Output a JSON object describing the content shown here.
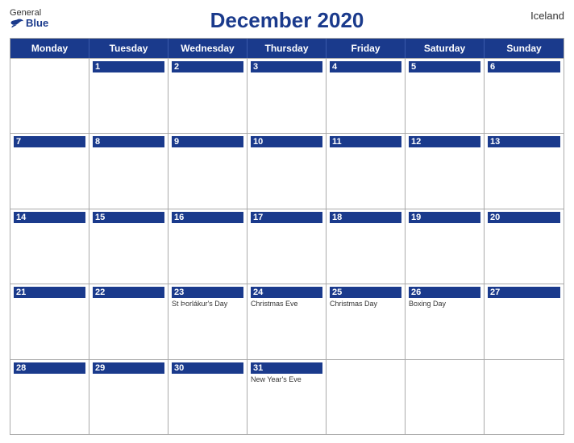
{
  "header": {
    "logo_general": "General",
    "logo_blue": "Blue",
    "title": "December 2020",
    "country": "Iceland"
  },
  "day_headers": [
    "Monday",
    "Tuesday",
    "Wednesday",
    "Thursday",
    "Friday",
    "Saturday",
    "Sunday"
  ],
  "weeks": [
    [
      {
        "day": "",
        "holiday": ""
      },
      {
        "day": "1",
        "holiday": ""
      },
      {
        "day": "2",
        "holiday": ""
      },
      {
        "day": "3",
        "holiday": ""
      },
      {
        "day": "4",
        "holiday": ""
      },
      {
        "day": "5",
        "holiday": ""
      },
      {
        "day": "6",
        "holiday": ""
      }
    ],
    [
      {
        "day": "7",
        "holiday": ""
      },
      {
        "day": "8",
        "holiday": ""
      },
      {
        "day": "9",
        "holiday": ""
      },
      {
        "day": "10",
        "holiday": ""
      },
      {
        "day": "11",
        "holiday": ""
      },
      {
        "day": "12",
        "holiday": ""
      },
      {
        "day": "13",
        "holiday": ""
      }
    ],
    [
      {
        "day": "14",
        "holiday": ""
      },
      {
        "day": "15",
        "holiday": ""
      },
      {
        "day": "16",
        "holiday": ""
      },
      {
        "day": "17",
        "holiday": ""
      },
      {
        "day": "18",
        "holiday": ""
      },
      {
        "day": "19",
        "holiday": ""
      },
      {
        "day": "20",
        "holiday": ""
      }
    ],
    [
      {
        "day": "21",
        "holiday": ""
      },
      {
        "day": "22",
        "holiday": ""
      },
      {
        "day": "23",
        "holiday": "St Þorlákur's Day"
      },
      {
        "day": "24",
        "holiday": "Christmas Eve"
      },
      {
        "day": "25",
        "holiday": "Christmas Day"
      },
      {
        "day": "26",
        "holiday": "Boxing Day"
      },
      {
        "day": "27",
        "holiday": ""
      }
    ],
    [
      {
        "day": "28",
        "holiday": ""
      },
      {
        "day": "29",
        "holiday": ""
      },
      {
        "day": "30",
        "holiday": ""
      },
      {
        "day": "31",
        "holiday": "New Year's Eve"
      },
      {
        "day": "",
        "holiday": ""
      },
      {
        "day": "",
        "holiday": ""
      },
      {
        "day": "",
        "holiday": ""
      }
    ]
  ]
}
